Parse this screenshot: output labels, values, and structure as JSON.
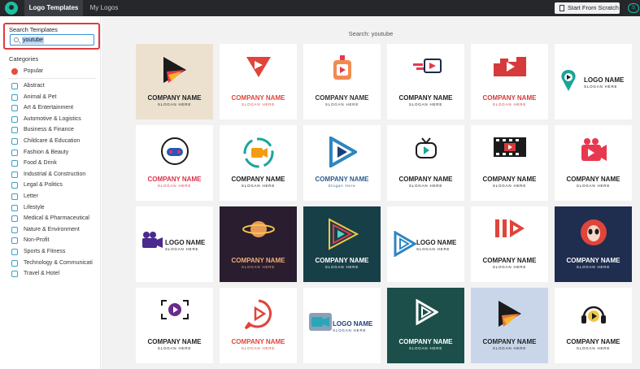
{
  "topbar": {
    "tabs": [
      "Logo Templates",
      "My Logos"
    ],
    "scratch_button": "Start From Scratch"
  },
  "sidebar": {
    "search_title": "Search Templates",
    "search_value": "youtube",
    "categories_heading": "Categories",
    "categories": [
      "Popular",
      "Abstract",
      "Animal & Pet",
      "Art & Entertainment",
      "Automotive & Logistics",
      "Business & Finance",
      "Childcare & Education",
      "Fashion & Beauty",
      "Food & Drink",
      "Industrial & Construction",
      "Legal & Politics",
      "Letter",
      "Lifestyle",
      "Medical & Pharmaceutical",
      "Nature & Environment",
      "Non-Profit",
      "Sports & Fitness",
      "Technology & Communicati",
      "Travel & Hotel"
    ]
  },
  "main": {
    "search_label": "Search: youtube",
    "cards": [
      {
        "name": "COMPANY NAME",
        "slogan": "SLOGAN HERE",
        "bg": "#ece1cf",
        "text": "#222222",
        "accent": "#e8384f",
        "icon": "play-gradient-icon"
      },
      {
        "name": "COMPANY NAME",
        "slogan": "SLOGAN HERE",
        "bg": "#ffffff",
        "text": "#e0443a",
        "accent": "#e0443a",
        "icon": "triangle-play-icon"
      },
      {
        "name": "COMPANY NAME",
        "slogan": "SLOGAN HERE",
        "bg": "#ffffff",
        "text": "#333333",
        "accent": "#f06a6a",
        "icon": "tv-play-icon"
      },
      {
        "name": "COMPANY NAME",
        "slogan": "SLOGAN HERE",
        "bg": "#ffffff",
        "text": "#222222",
        "accent": "#e8384f",
        "icon": "speed-tv-icon"
      },
      {
        "name": "COMPANY NAME",
        "slogan": "SLOGAN HERE",
        "bg": "#ffffff",
        "text": "#d63a3a",
        "accent": "#d63a3a",
        "icon": "city-play-icon"
      },
      {
        "name": "LOGO NAME",
        "slogan": "SLOGAN HERE",
        "bg": "#ffffff",
        "text": "#222222",
        "accent": "#1aa59a",
        "icon": "pin-play-icon"
      },
      {
        "name": "COMPANY NAME",
        "slogan": "SLOGAN HERE",
        "bg": "#ffffff",
        "text": "#d9334a",
        "accent": "#2a55b8",
        "icon": "gamepad-icon"
      },
      {
        "name": "COMPANY NAME",
        "slogan": "SLOGAN HERE",
        "bg": "#ffffff",
        "text": "#222222",
        "accent": "#f39c12",
        "icon": "camera-ring-icon"
      },
      {
        "name": "COMPANY NAME",
        "slogan": "Slogan Here",
        "bg": "#ffffff",
        "text": "#2c5d8f",
        "accent": "#2e86c1",
        "icon": "play-blue-icon"
      },
      {
        "name": "COMPANY NAME",
        "slogan": "SLOGAN HERE",
        "bg": "#ffffff",
        "text": "#222222",
        "accent": "#1aa59a",
        "icon": "retro-tv-icon"
      },
      {
        "name": "COMPANY NAME",
        "slogan": "SLOGAN HERE",
        "bg": "#ffffff",
        "text": "#222222",
        "accent": "#d63a3a",
        "icon": "film-strip-icon"
      },
      {
        "name": "COMPANY NAME",
        "slogan": "SLOGAN HERE",
        "bg": "#ffffff",
        "text": "#222222",
        "accent": "#e8384f",
        "icon": "camera-play-icon"
      },
      {
        "name": "LOGO NAME",
        "slogan": "SLOGAN HERE",
        "bg": "#ffffff",
        "text": "#222222",
        "accent": "#4a2a8c",
        "icon": "video-camera-icon"
      },
      {
        "name": "COMPANY NAME",
        "slogan": "SLOGAN HERE",
        "bg": "#2a1d2f",
        "text": "#f0b07a",
        "accent": "#e89a5a",
        "icon": "planet-icon"
      },
      {
        "name": "COMPANY NAME",
        "slogan": "SLOGAN HERE",
        "bg": "#173f47",
        "text": "#ffffff",
        "accent": "#f2c744",
        "icon": "neon-play-icon"
      },
      {
        "name": "LOGO NAME",
        "slogan": "SLOGAN HERE",
        "bg": "#ffffff",
        "text": "#222222",
        "accent": "#2e86c1",
        "icon": "play-outline-icon"
      },
      {
        "name": "COMPANY NAME",
        "slogan": "SLOGAN HERE",
        "bg": "#ffffff",
        "text": "#222222",
        "accent": "#e0443a",
        "icon": "pause-play-icon"
      },
      {
        "name": "COMPANY NAME",
        "slogan": "SLOGAN HERE",
        "bg": "#1f2d4f",
        "text": "#ffffff",
        "accent": "#e0443a",
        "icon": "alien-icon"
      },
      {
        "name": "COMPANY NAME",
        "slogan": "SLOGAN HERE",
        "bg": "#ffffff",
        "text": "#222222",
        "accent": "#6a2a8a",
        "icon": "frame-play-icon"
      },
      {
        "name": "COMPANY NAME",
        "slogan": "SLOGAN HERE",
        "bg": "#ffffff",
        "text": "#e0443a",
        "accent": "#e0443a",
        "icon": "bubble-play-icon"
      },
      {
        "name": "LOGO NAME",
        "slogan": "SLOGAN HERE",
        "bg": "#ffffff",
        "text": "#1f3f7a",
        "accent": "#2aa6b8",
        "icon": "camcorder-icon"
      },
      {
        "name": "COMPANY NAME",
        "slogan": "SLOGAN HERE",
        "bg": "#1d4f4a",
        "text": "#ffffff",
        "accent": "#ffffff",
        "icon": "play-outline-icon"
      },
      {
        "name": "COMPANY NAME",
        "slogan": "SLOGAN HERE",
        "bg": "#c9d6ea",
        "text": "#222222",
        "accent": "#e8743a",
        "icon": "play-gradient-icon"
      },
      {
        "name": "COMPANY NAME",
        "slogan": "SLOGAN HERE",
        "bg": "#ffffff",
        "text": "#222222",
        "accent": "#f2c744",
        "icon": "headphones-icon"
      }
    ]
  }
}
